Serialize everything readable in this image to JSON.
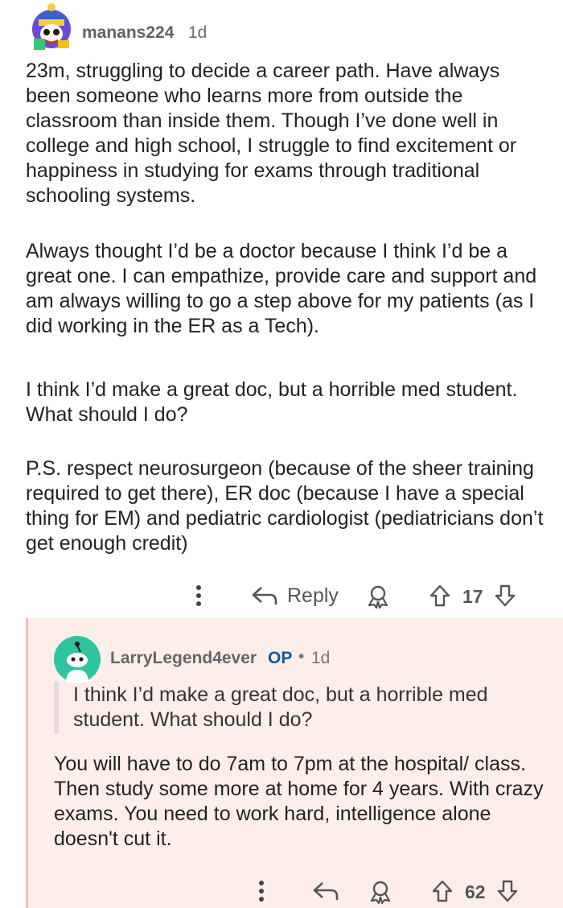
{
  "comment": {
    "username": "manans224",
    "age": "1d",
    "paragraphs": [
      "23m, struggling to decide a career path. Have always been someone who learns more from outside the classroom than inside them. Though I’ve done well in college and high school, I struggle to find excitement or happiness in studying for exams through traditional schooling systems.",
      "Always thought I’d be a doctor because I think I’d be a great one. I can empathize, provide care and support and am always willing to go a step above for my patients (as I did working in the ER as a Tech).",
      "I think I’d make a great doc, but a horrible med student. What should I do?",
      "P.S. respect neurosurgeon (because of the sheer training required to get there), ER doc (because I have a special thing for EM) and pediatric cardiologist (pediatricians don’t get enough credit)"
    ],
    "reply_label": "Reply",
    "votes": "17",
    "icons": {
      "more": "more-vertical-icon",
      "reply": "reply-arrow-icon",
      "award": "award-icon",
      "upvote": "upvote-arrow-icon",
      "downvote": "downvote-arrow-icon"
    }
  },
  "reply": {
    "username": "LarryLegend4ever",
    "op_badge": "OP",
    "separator": "•",
    "age": "1d",
    "quote": "I think I’d make a great doc, but a horrible med student. What should I do?",
    "body": "You will have to do 7am to 7pm at the hospital/ class. Then study some more at home for 4 years. With crazy exams. You need to work hard, intelligence alone doesn't cut it.",
    "votes": "62",
    "background_color": "#fdeeea",
    "avatar_color": "#2ec4a0"
  }
}
